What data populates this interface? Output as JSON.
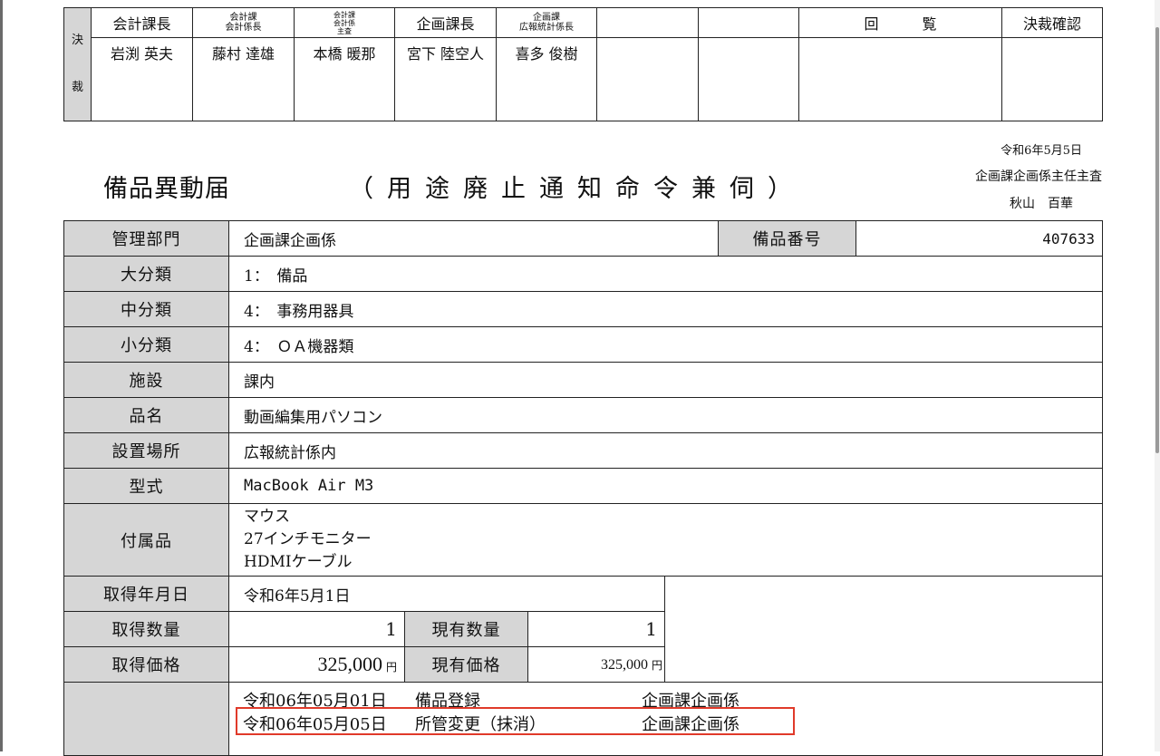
{
  "approval": {
    "kessai_label": "決\n\n裁",
    "headers": [
      {
        "lines": [
          "会計課長"
        ]
      },
      {
        "lines": [
          "会計課",
          "会計係長"
        ]
      },
      {
        "lines": [
          "会計課",
          "会計係",
          "主査"
        ]
      },
      {
        "lines": [
          "企画課長"
        ]
      },
      {
        "lines": [
          "企画課",
          "広報統計係長"
        ]
      },
      {
        "lines": [
          ""
        ]
      },
      {
        "lines": [
          ""
        ]
      },
      {
        "lines": [
          "回　　　覧"
        ]
      },
      {
        "lines": [
          "決裁確認"
        ]
      }
    ],
    "names": [
      "岩渕 英夫",
      "藤村 達雄",
      "本橋 暖那",
      "宮下 陸空人",
      "喜多 俊樹",
      "",
      "",
      "",
      ""
    ]
  },
  "header": {
    "title": "備品異動届",
    "subtitle": "（用途廃止通知命令兼伺）",
    "date": "令和6年5月5日",
    "dept": "企画課企画係主任主査",
    "person": "秋山　百華"
  },
  "fields": {
    "dept_label": "管理部門",
    "dept_value": "企画課企画係",
    "item_no_label": "備品番号",
    "item_no_value": "407633",
    "major_label": "大分類",
    "major_value": "1：　備品",
    "middle_label": "中分類",
    "middle_value": "4：　事務用器具",
    "minor_label": "小分類",
    "minor_value": "4：　ＯＡ機器類",
    "facility_label": "施設",
    "facility_value": "課内",
    "name_label": "品名",
    "name_value": "動画編集用パソコン",
    "location_label": "設置場所",
    "location_value": "広報統計係内",
    "model_label": "型式",
    "model_value": "MacBook Air M3",
    "accessories_label": "付属品",
    "accessories": [
      "マウス",
      "27インチモニター",
      "HDMIケーブル"
    ],
    "acq_date_label": "取得年月日",
    "acq_date_value": "令和6年5月1日",
    "acq_qty_label": "取得数量",
    "acq_qty_value": "1",
    "cur_qty_label": "現有数量",
    "cur_qty_value": "1",
    "acq_price_label": "取得価格",
    "acq_price_value": "325,000",
    "cur_price_label": "現有価格",
    "cur_price_value": "325,000",
    "yen": "円"
  },
  "history": [
    {
      "date": "令和06年05月01日",
      "action": "備品登録",
      "owner": "企画課企画係"
    },
    {
      "date": "令和06年05月05日",
      "action": "所管変更（抹消）",
      "owner": "企画課企画係"
    }
  ],
  "colors": {
    "label_bg": "#d6d6d6",
    "highlight": "#e03a2a"
  }
}
